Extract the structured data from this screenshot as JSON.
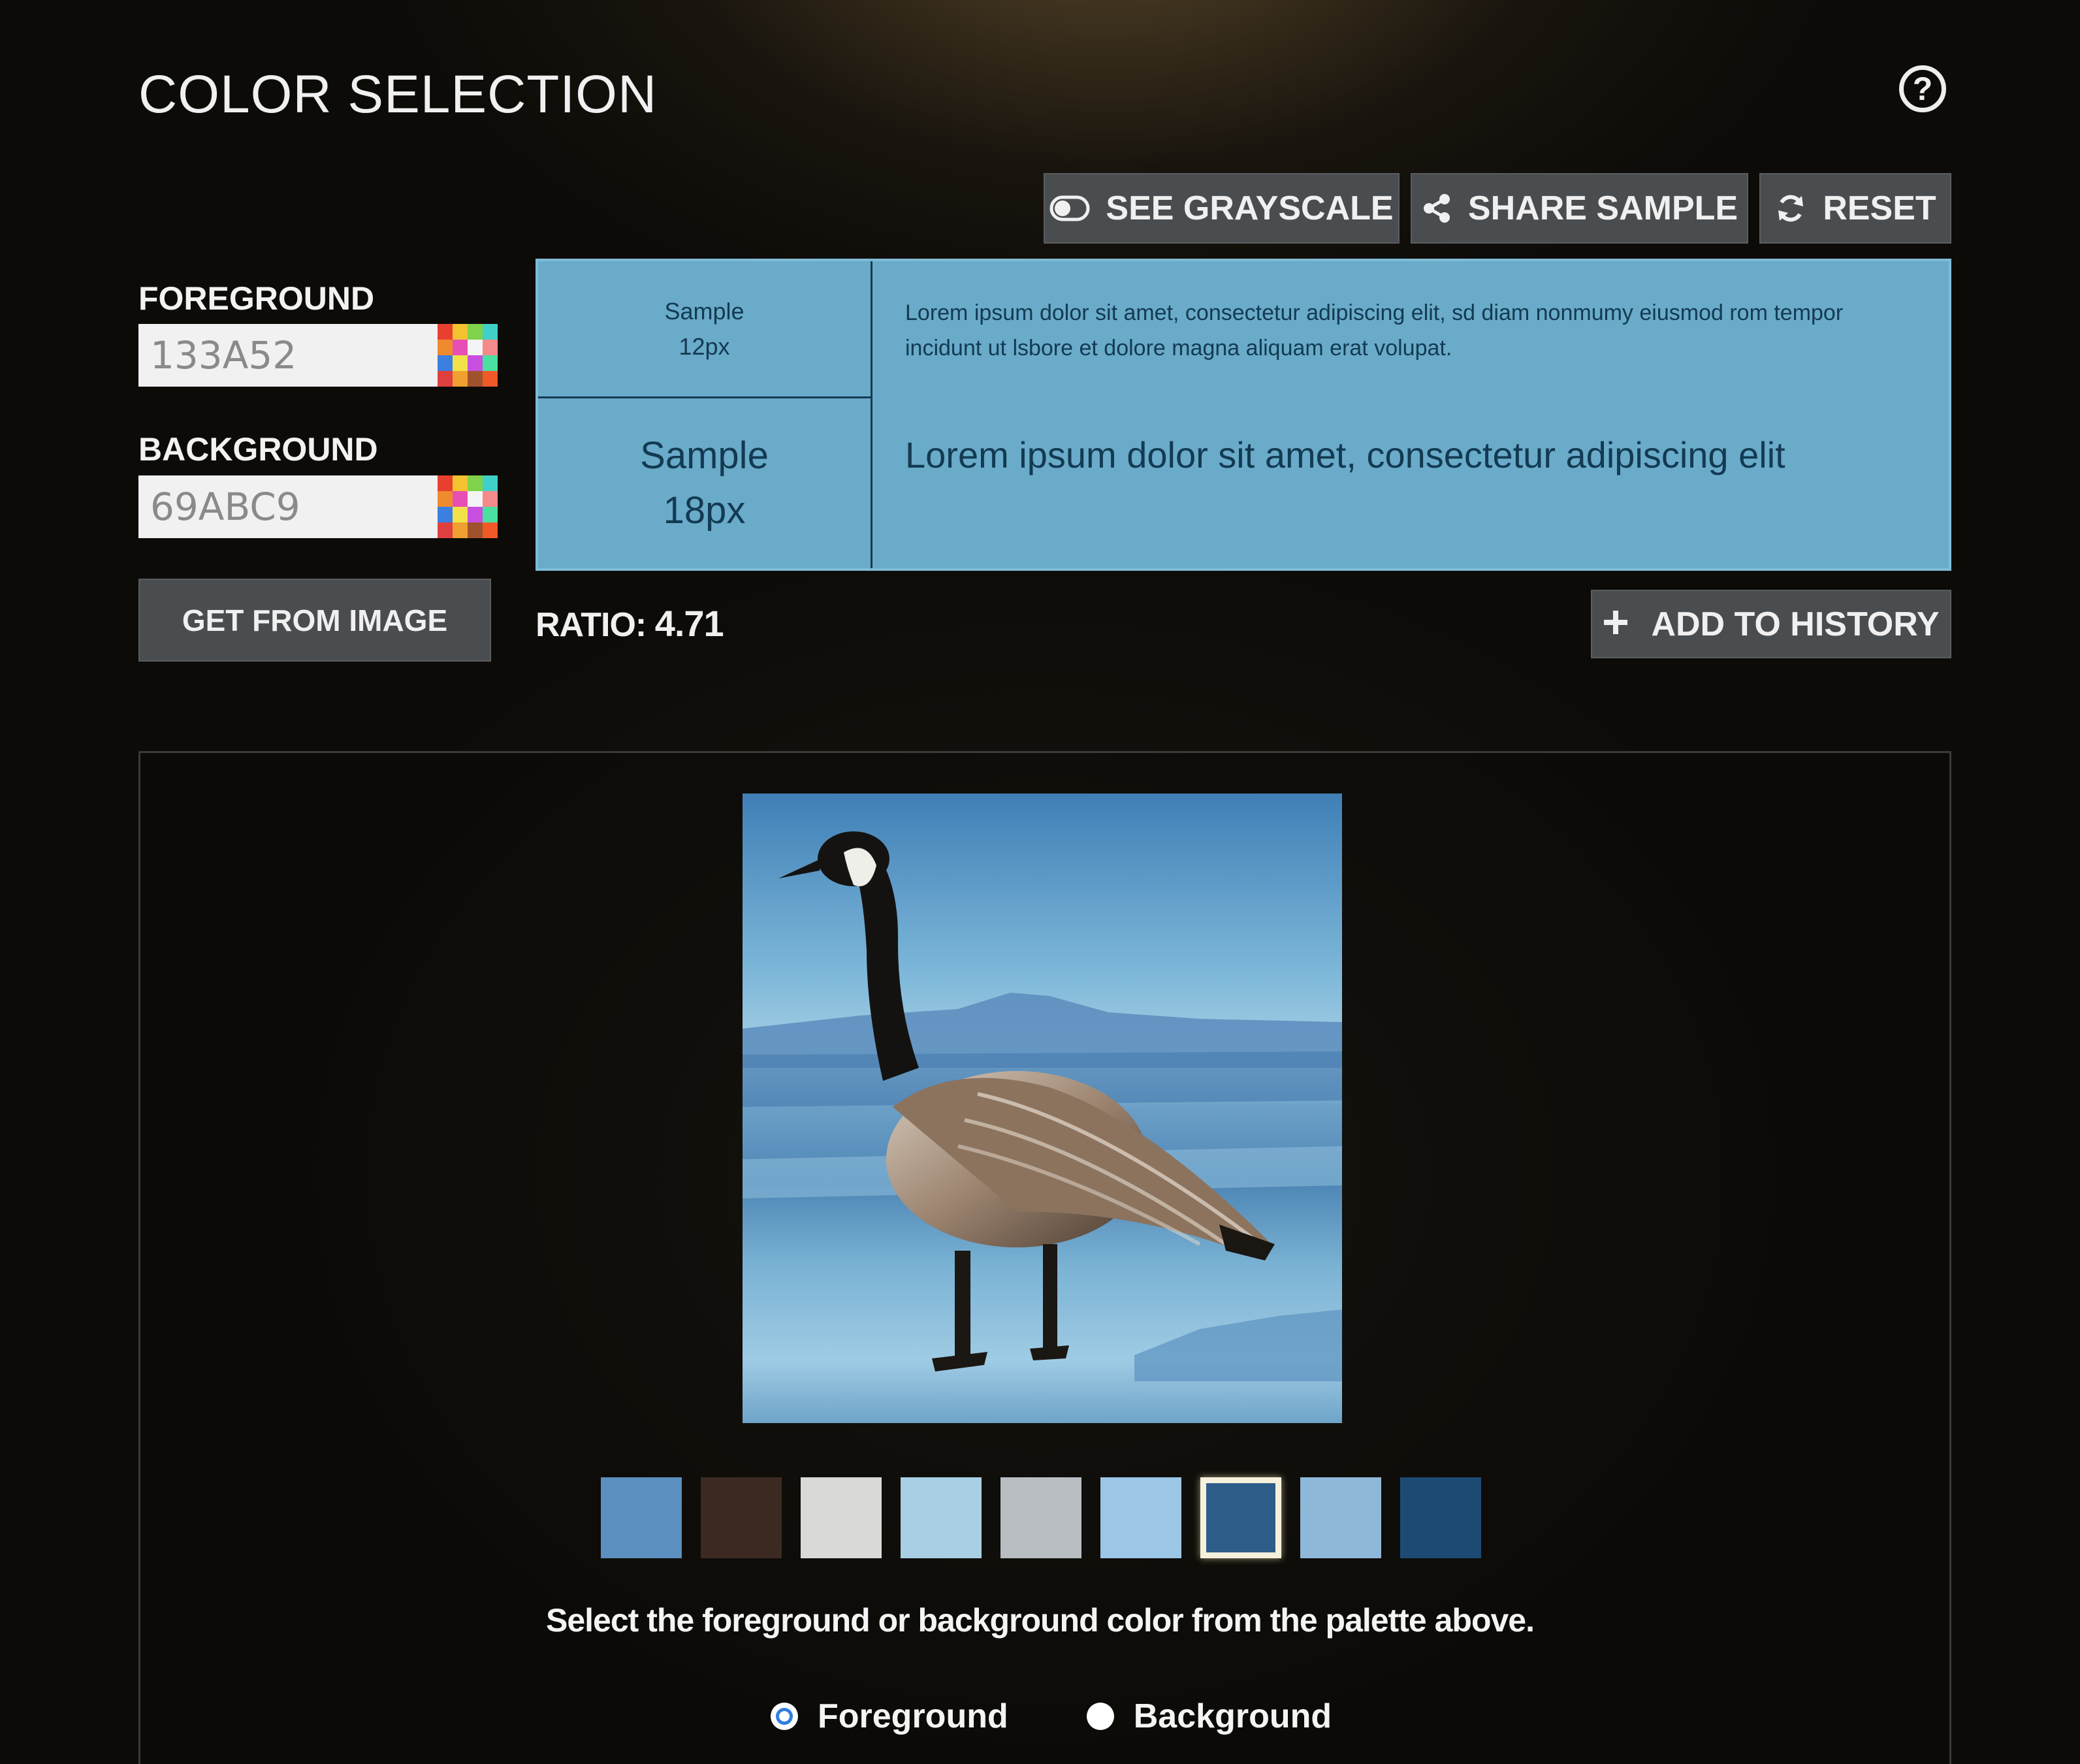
{
  "header": {
    "title": "COLOR SELECTION",
    "help_label": "?"
  },
  "toolbar": {
    "grayscale_label": "SEE GRAYSCALE",
    "share_label": "SHARE SAMPLE",
    "reset_label": "RESET"
  },
  "inputs": {
    "foreground_label": "FOREGROUND",
    "foreground_value": "133A52",
    "background_label": "BACKGROUND",
    "background_value": "69ABC9",
    "get_from_image_label": "GET FROM IMAGE"
  },
  "preview": {
    "sample12_line1": "Sample",
    "sample12_line2": "12px",
    "sample18_line1": "Sample",
    "sample18_line2": "18px",
    "lorem12": "Lorem ipsum dolor sit amet, consectetur adipiscing elit, sd diam nonmumy eiusmod rom tempor incidunt ut lsbore et dolore magna aliquam erat volupat.",
    "lorem18": "Lorem ipsum dolor sit amet, consectetur adipiscing elit",
    "foreground_color": "#133A52",
    "background_color": "#69ABC9"
  },
  "ratio": {
    "label": "RATIO:",
    "value": "4.71"
  },
  "history": {
    "add_label": "ADD TO HISTORY"
  },
  "palette": {
    "swatches": [
      "#5a8fbf",
      "#3c2a22",
      "#d9d9d6",
      "#a9cfe4",
      "#b9bec3",
      "#9cc7e6",
      "#2f5d8a",
      "#8fb8d8",
      "#1d4a73"
    ],
    "selected_index": 6
  },
  "instruction": "Select the foreground or background color from the palette above.",
  "target": {
    "foreground_label": "Foreground",
    "background_label": "Background",
    "selected": "Foreground"
  },
  "colors": {
    "button_bg": "#4a4d50",
    "radio_accent": "#2f7fe0"
  }
}
